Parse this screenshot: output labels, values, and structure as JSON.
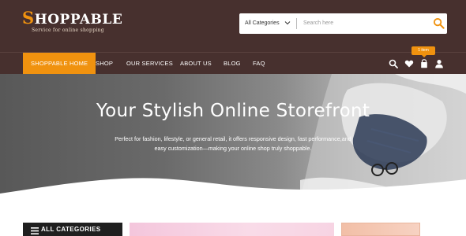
{
  "header": {
    "logo_text": "HOPPABLE",
    "logo_initial": "S",
    "tagline": "Service for online shopping",
    "category_select": "All Categories",
    "search_placeholder": "Search here"
  },
  "nav": {
    "items": [
      "SHOPPABLE HOME",
      "SHOP",
      "OUR SERVICES",
      "ABOUT US",
      "BLOG",
      "FAQ"
    ],
    "active_index": 0,
    "cart_badge": "1 item"
  },
  "hero": {
    "title": "Your Stylish Online Storefront",
    "subtitle_line1": "Perfect for fashion, lifestyle, or general retail, it offers responsive design, fast performance,and",
    "subtitle_line2": "easy customization—making your online shop truly shoppable."
  },
  "sidebar": {
    "all_categories": "ALL CATEGORIES"
  },
  "colors": {
    "brand_dark": "#47302e",
    "accent": "#f0920f"
  },
  "icons": [
    "search-icon",
    "chevron-down-icon",
    "heart-icon",
    "shopping-bag-icon",
    "user-icon",
    "menu-icon"
  ]
}
